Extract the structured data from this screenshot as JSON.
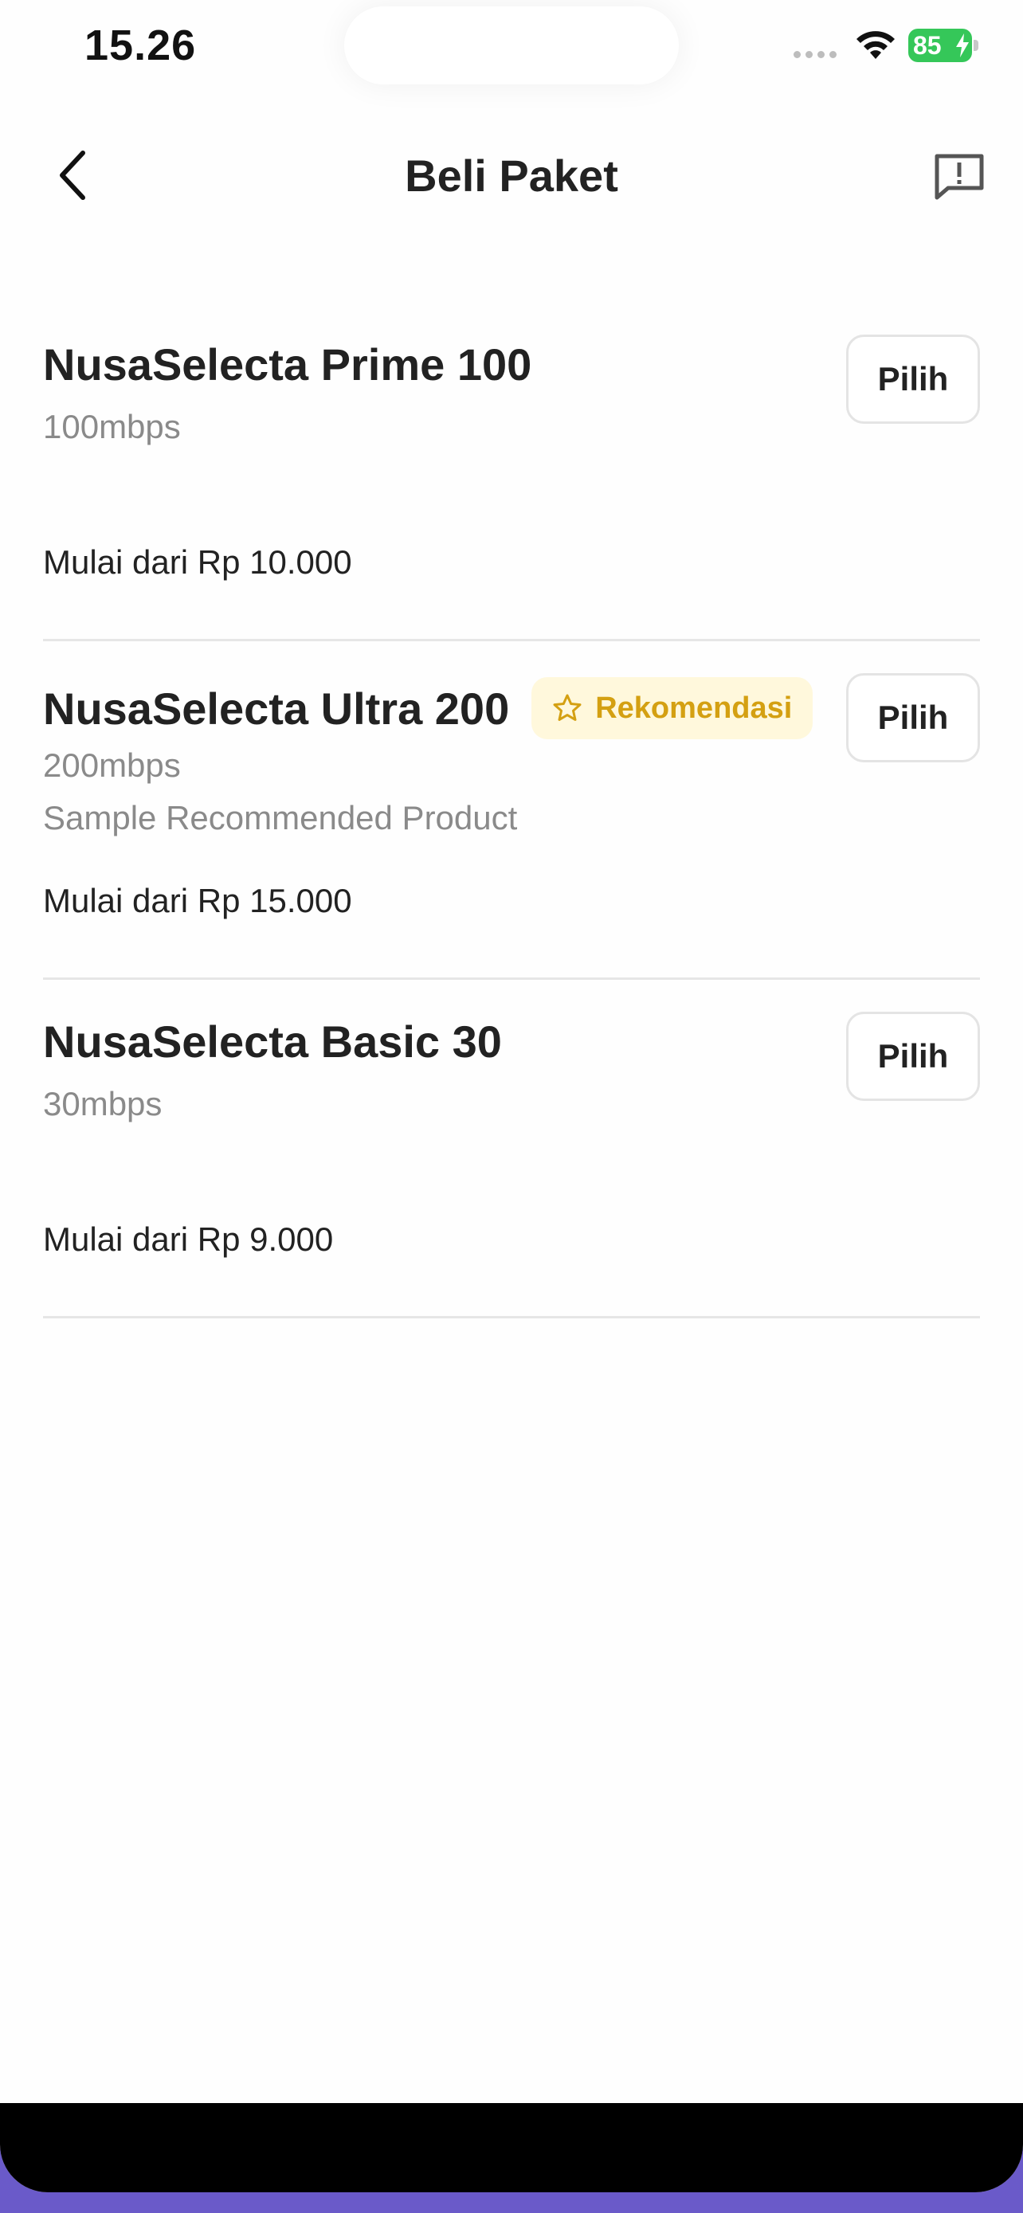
{
  "status_bar": {
    "time": "15.26",
    "battery": "85"
  },
  "header": {
    "title": "Beli Paket"
  },
  "packages": [
    {
      "name": "NusaSelecta Prime 100",
      "speed": "100mbps",
      "description": "",
      "price": "Mulai dari Rp 10.000",
      "badge": "",
      "button": "Pilih"
    },
    {
      "name": "NusaSelecta Ultra 200",
      "speed": "200mbps",
      "description": "Sample Recommended Product",
      "price": "Mulai dari Rp 15.000",
      "badge": "Rekomendasi",
      "button": "Pilih"
    },
    {
      "name": "NusaSelecta Basic 30",
      "speed": "30mbps",
      "description": "",
      "price": "Mulai dari Rp 9.000",
      "badge": "",
      "button": "Pilih"
    }
  ],
  "colors": {
    "badge_text": "#d4a012",
    "badge_bg": "#fff8dc",
    "battery": "#35c759"
  },
  "icons": {
    "back": "chevron-left-icon",
    "report": "report-message-icon",
    "badge": "star-outline-icon"
  }
}
